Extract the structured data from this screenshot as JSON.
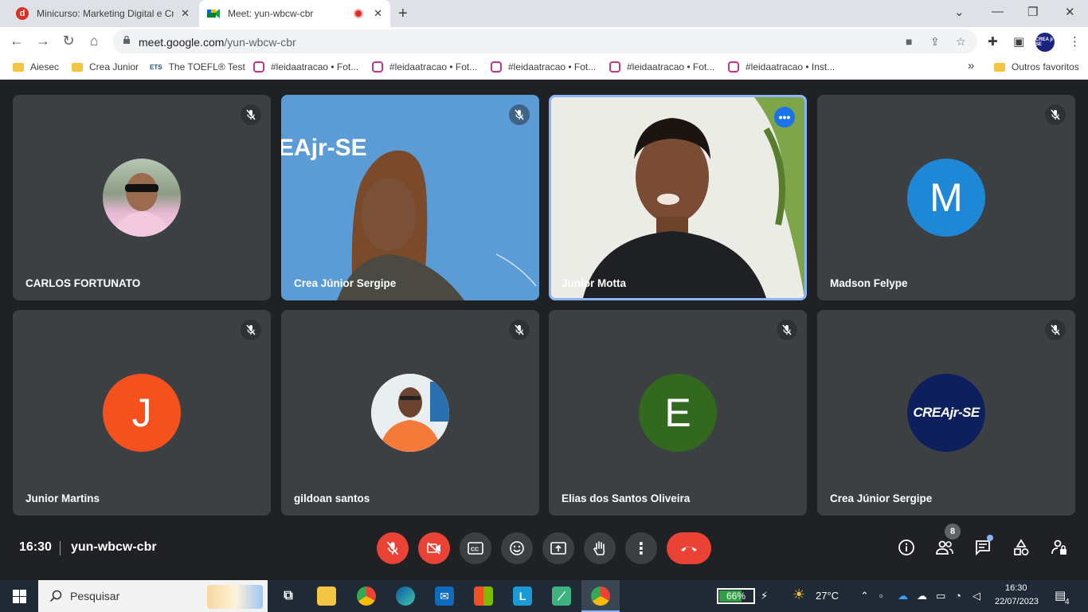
{
  "browser": {
    "tabs": [
      {
        "title": "Minicurso: Marketing Digital e Cr",
        "favicon": "d"
      },
      {
        "title": "Meet: yun-wbcw-cbr"
      }
    ],
    "url_domain": "meet.google.com",
    "url_path": "/yun-wbcw-cbr",
    "profile_label": "CREA jr SE",
    "bookmarks": [
      {
        "label": "Aiesec",
        "icon": "folder"
      },
      {
        "label": "Crea Junior",
        "icon": "folder"
      },
      {
        "label": "The TOEFL® Test",
        "icon": "ets"
      },
      {
        "label": "#leidaatracao • Fot...",
        "icon": "instagram"
      },
      {
        "label": "#leidaatracao • Fot...",
        "icon": "instagram"
      },
      {
        "label": "#leidaatracao • Fot...",
        "icon": "instagram"
      },
      {
        "label": "#leidaatracao • Fot...",
        "icon": "instagram"
      },
      {
        "label": "#leidaatracao • Inst...",
        "icon": "instagram"
      }
    ],
    "more_bookmarks": "»",
    "other_bookmarks": "Outros favoritos",
    "ets_text": "ETS"
  },
  "meet": {
    "participants": [
      {
        "name": "CARLOS FORTUNATO",
        "type": "photo-avatar",
        "muted": true
      },
      {
        "name": "Crea Júnior Sergipe",
        "type": "video",
        "muted": true,
        "overlay_text": "EAjr-SE"
      },
      {
        "name": "Junior Motta",
        "type": "video",
        "muted": false,
        "speaking": true
      },
      {
        "name": "Madson Felype",
        "type": "letter",
        "letter": "M",
        "color": "#1e88d6",
        "muted": true
      },
      {
        "name": "Junior Martins",
        "type": "letter",
        "letter": "J",
        "color": "#f4511e",
        "muted": true
      },
      {
        "name": "gildoan santos",
        "type": "photo-avatar",
        "muted": true
      },
      {
        "name": "Elias dos Santos Oliveira",
        "type": "letter",
        "letter": "E",
        "color": "#33691e",
        "muted": true
      },
      {
        "name": "Crea Júnior Sergipe",
        "type": "logo",
        "logo_text": "CREAjr-SE",
        "muted": true
      }
    ],
    "time": "16:30",
    "meeting_code": "yun-wbcw-cbr",
    "participant_count": "8"
  },
  "taskbar": {
    "search_placeholder": "Pesquisar",
    "battery": "66%",
    "battery_level": 0.66,
    "weather": "27°C",
    "clock_time": "16:30",
    "clock_date": "22/07/2023",
    "notifications": "4",
    "app_l": "L"
  }
}
